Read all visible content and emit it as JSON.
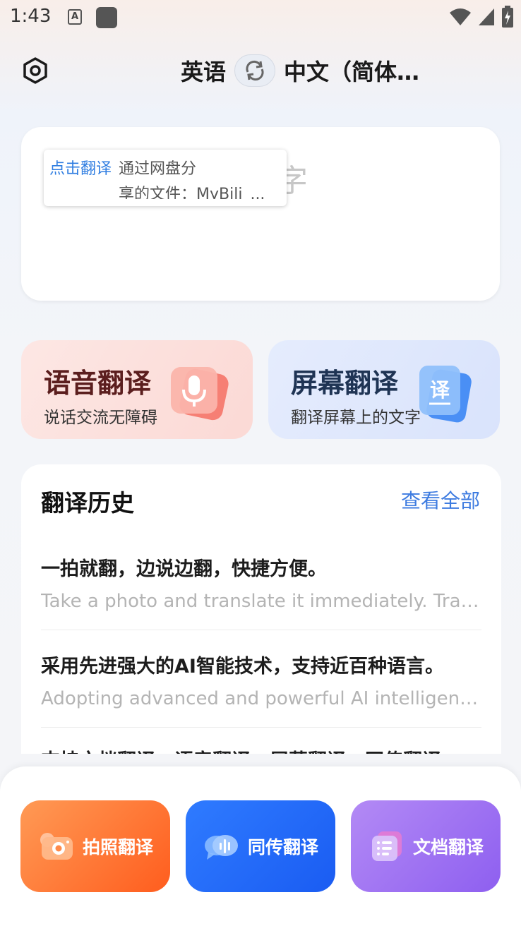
{
  "status": {
    "time": "1:43",
    "a_badge": "A"
  },
  "header": {
    "source_lang": "英语",
    "target_lang": "中文（简体…"
  },
  "input": {
    "placeholder_char": "字",
    "tooltip": {
      "action": "点击翻译",
      "line1": "通过网盘分",
      "line2": "享的文件：MyBili_..."
    }
  },
  "features": {
    "voice": {
      "title": "语音翻译",
      "subtitle": "说话交流无障碍"
    },
    "screen": {
      "title": "屏幕翻译",
      "subtitle": "翻译屏幕上的文字",
      "icon_text": "译"
    }
  },
  "history": {
    "title": "翻译历史",
    "view_all": "查看全部",
    "items": [
      {
        "zh": "一拍就翻，边说边翻，快捷方便。",
        "en": "Take a photo and translate it immediately. Translate while speaking."
      },
      {
        "zh": "采用先进强大的AI智能技术，支持近百种语言。",
        "en": "Adopting advanced and powerful AI intelligent technology, supporting nearly a hundred languages."
      },
      {
        "zh": "支持文档翻译，语音翻译，屏幕翻译，同传翻译",
        "en": ""
      }
    ]
  },
  "bottom": {
    "photo": "拍照翻译",
    "simul": "同传翻译",
    "doc": "文档翻译"
  },
  "colors": {
    "accent_blue": "#3d7be0",
    "photo_orange": "#ff5d1e",
    "simul_blue": "#1a5cf2",
    "doc_purple": "#8e5ff0"
  }
}
